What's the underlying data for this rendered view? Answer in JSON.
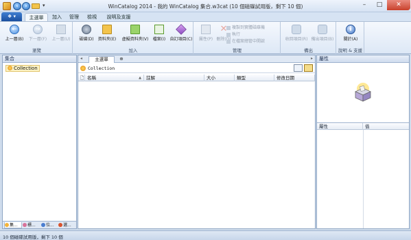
{
  "window": {
    "title": "WinCatalog 2014 - 我的 WinCatalog 集合.w3cat (10 個磁碟試用版，剩下 10 個)",
    "quick_access_menu": "▾"
  },
  "ribbon_tabs": {
    "app_button": "❖ ▾",
    "tabs": [
      "主選單",
      "加入",
      "管理",
      "檢視",
      "說明及支援"
    ]
  },
  "ribbon": {
    "navigation": {
      "label": "瀏覽",
      "buttons": [
        "上一層(B)",
        "下一層(F)",
        "上一層(U)"
      ]
    },
    "add": {
      "label": "加入",
      "buttons": [
        "磁碟(D)",
        "資料夾(E)",
        "虛擬資料夾(V)",
        "檔案(I)",
        "自訂項目(C)"
      ]
    },
    "manage": {
      "label": "管理",
      "buttons": [
        "屬性(P)",
        "刪除(D)"
      ],
      "small_items": [
        "複製到實體磁碟機",
        "執行",
        "在檔案總管中開啟"
      ]
    },
    "export": {
      "label": "備出",
      "buttons": [
        "收回項目(R)",
        "備出項目(B)"
      ]
    },
    "help": {
      "label": "說明 & 支援",
      "buttons": [
        "關於(A)"
      ]
    }
  },
  "left_pane": {
    "title": "集合",
    "tree": [
      "Collection"
    ],
    "bottom_tabs": [
      "集...",
      "標...",
      "位...",
      "選..."
    ]
  },
  "center_pane": {
    "doc_tabs": [
      "主選單",
      "⊕"
    ],
    "path": "Collection",
    "columns": [
      "名稱",
      "註解",
      "大小",
      "類型",
      "修改日期"
    ]
  },
  "right_pane": {
    "title": "屬性",
    "property_columns": [
      "屬性",
      "值"
    ]
  },
  "status": {
    "text": "10 個磁碟試用版，剩下 10 個"
  },
  "colors": {
    "accent": "#2c72c6",
    "ribbon_bg": "#dde8f6",
    "close": "#c8412c"
  }
}
